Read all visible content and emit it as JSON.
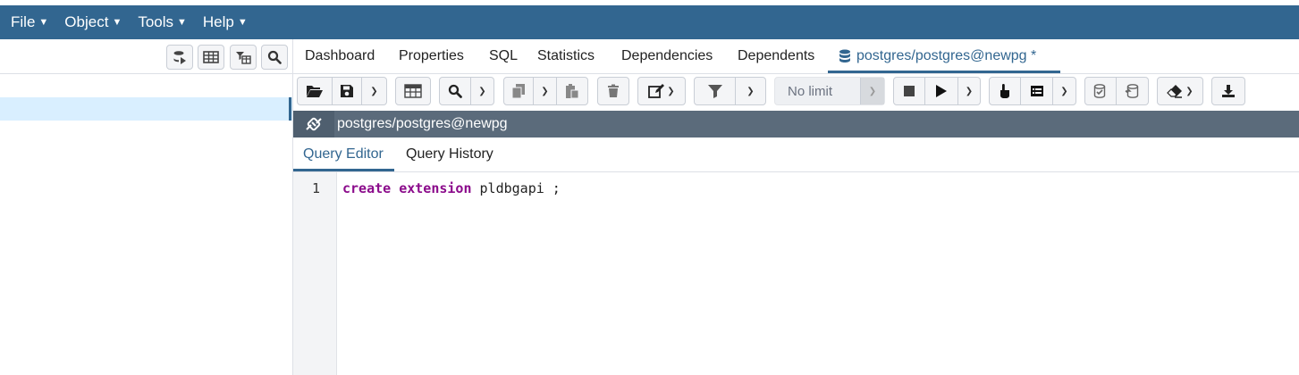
{
  "menu": [
    {
      "label": "File"
    },
    {
      "label": "Object"
    },
    {
      "label": "Tools"
    },
    {
      "label": "Help"
    }
  ],
  "tree_toolbar": {
    "icons": [
      "database-icon",
      "table-icon",
      "filter-table-icon",
      "search-icon"
    ]
  },
  "main_tabs": [
    {
      "label": "Dashboard"
    },
    {
      "label": "Properties"
    },
    {
      "label": "SQL"
    },
    {
      "label": "Statistics"
    },
    {
      "label": "Dependencies"
    },
    {
      "label": "Dependents"
    },
    {
      "label": "postgres/postgres@newpg *"
    }
  ],
  "toolbar": {
    "limit_value": "No limit"
  },
  "connection": {
    "label": "postgres/postgres@newpg"
  },
  "sub_tabs": [
    {
      "label": "Query Editor"
    },
    {
      "label": "Query History"
    }
  ],
  "editor": {
    "line_number": "1",
    "keyword1": "create",
    "keyword2": "extension",
    "rest": " pldbgapi ;"
  },
  "colors": {
    "brand": "#326690",
    "selection": "#d9efff",
    "keyword": "#8b0b8b"
  }
}
